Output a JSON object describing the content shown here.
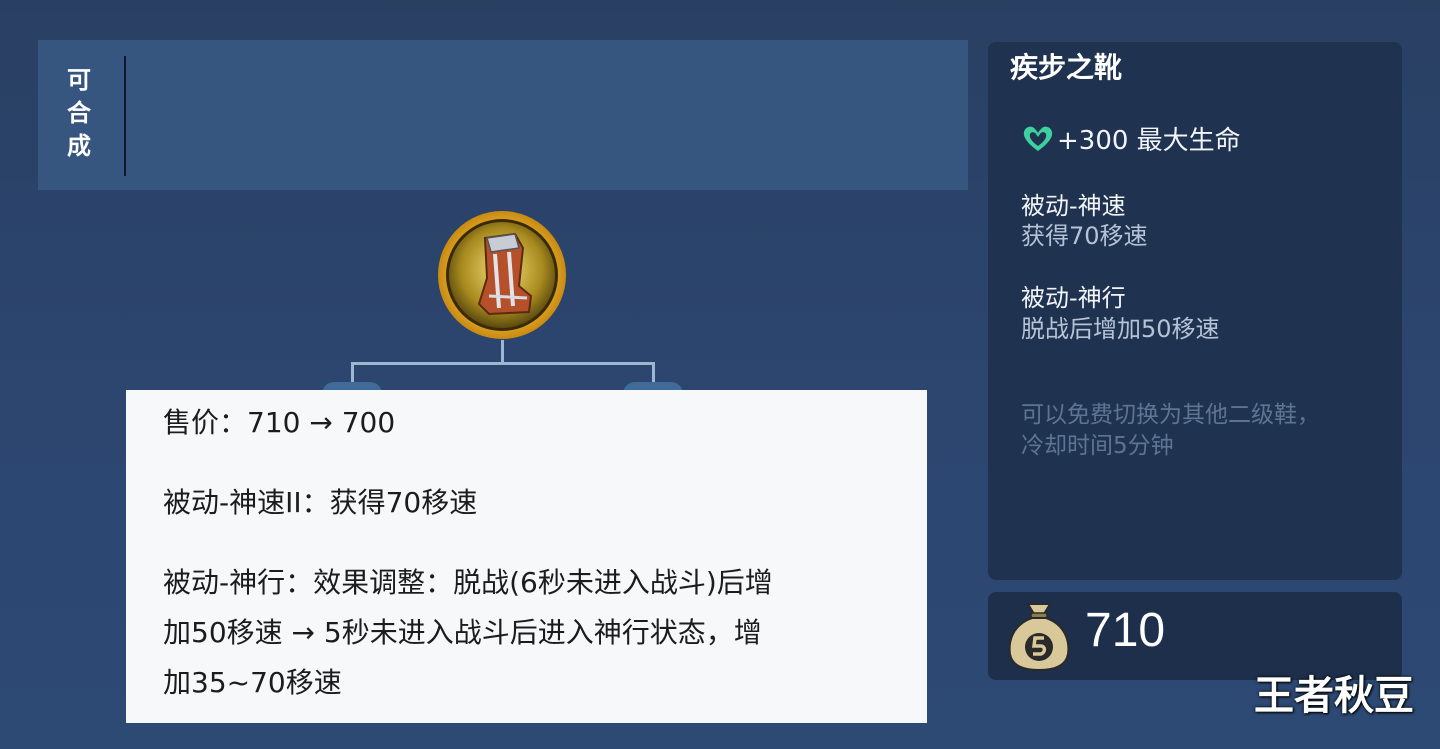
{
  "top_panel": {
    "label_chars": [
      "可",
      "合",
      "成"
    ]
  },
  "item": {
    "icon": "boots-icon"
  },
  "patch_note": {
    "price_line": "售价：710 → 700",
    "passive1_line": "被动-神速II：获得70移速",
    "passive2_line1": "被动-神行：效果调整：脱战(6秒未进入战斗)后增",
    "passive2_line2": "加50移速 →  5秒未进入战斗后进入神行状态，增",
    "passive2_line3": "加35~70移速"
  },
  "detail": {
    "title": "疾步之靴",
    "stat": {
      "icon": "heart-icon",
      "text": "+300 最大生命"
    },
    "passive1_title": "被动-神速",
    "passive1_desc": "获得70移速",
    "passive2_title": "被动-神行",
    "passive2_desc": "脱战后增加50移速",
    "hint_line1": "可以免费切换为其他二级鞋，",
    "hint_line2": "冷却时间5分钟"
  },
  "price": {
    "icon": "coin-bag-icon",
    "value": "710"
  },
  "watermark": "王者秋豆",
  "colors": {
    "accent_gold": "#f0c23a",
    "heart_green": "#3fd0a0",
    "panel_dark": "#1f3350"
  }
}
